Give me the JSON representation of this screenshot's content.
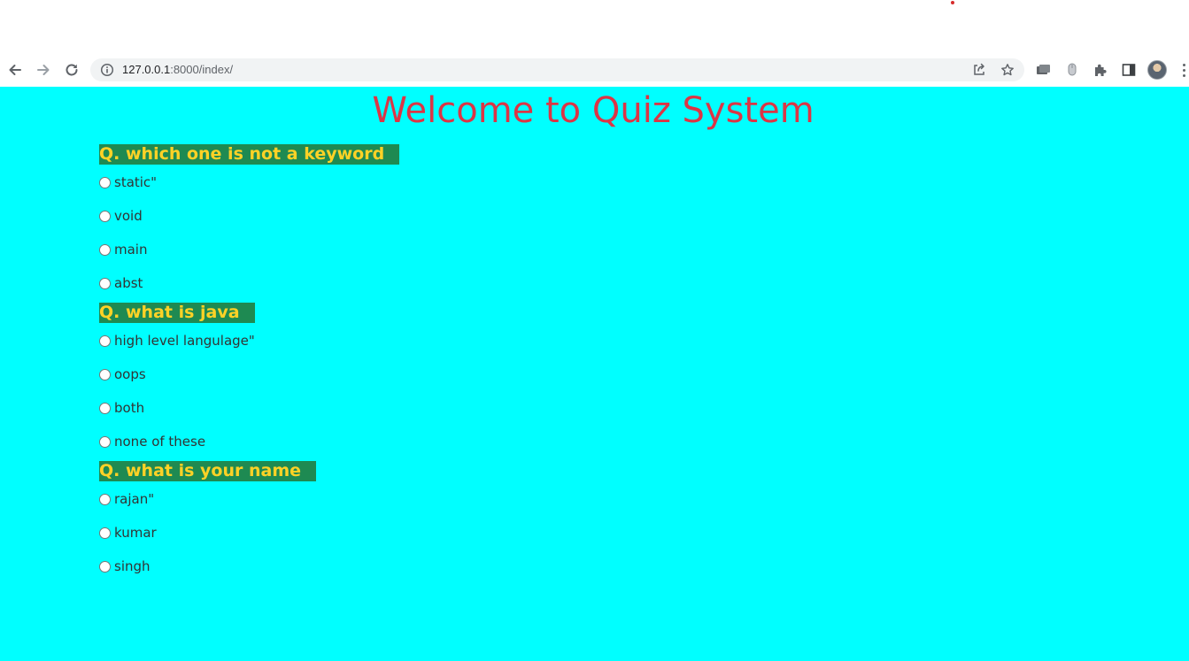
{
  "browser": {
    "url_host": "127.0.0.1",
    "url_rest": ":8000/index/",
    "icons": {
      "back": "arrow-left-icon",
      "forward": "arrow-right-icon",
      "reload": "reload-icon",
      "site_info": "info-icon",
      "share": "share-icon",
      "bookmark": "star-icon",
      "extension_1": "media-icon",
      "extension_2": "mouse-icon",
      "extensions": "puzzle-icon",
      "side_panel": "side-panel-icon",
      "profile": "avatar",
      "menu": "kebab-menu-icon"
    }
  },
  "page": {
    "title": "Welcome to Quiz System",
    "colors": {
      "background": "#00ffff",
      "title": "#dc3545",
      "question_bg": "#1e8a52",
      "question_text": "#ffd226"
    },
    "questions": [
      {
        "text": "Q. which one is not a keyword",
        "options": [
          "static\"",
          "void",
          "main",
          "abst"
        ]
      },
      {
        "text": "Q. what is java",
        "options": [
          "high level langulage\"",
          "oops",
          "both",
          "none of these"
        ]
      },
      {
        "text": "Q. what is your name",
        "options": [
          "rajan\"",
          "kumar",
          "singh"
        ]
      }
    ]
  }
}
